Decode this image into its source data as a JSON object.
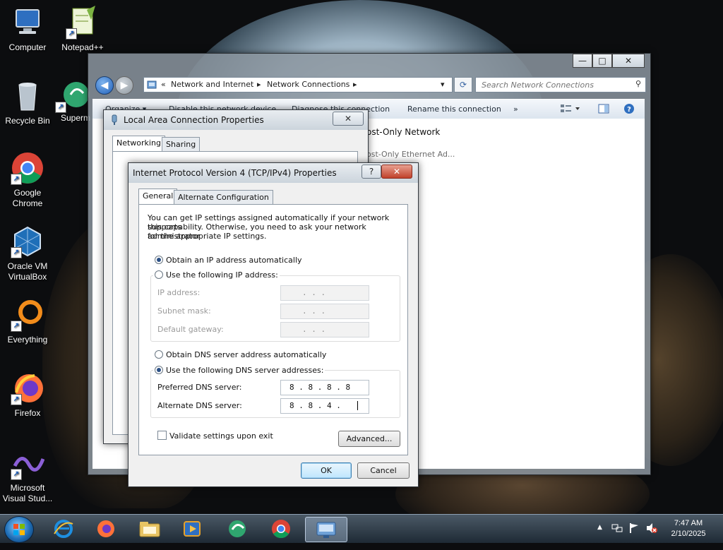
{
  "desktop": {
    "icons": [
      {
        "label_1": "Computer",
        "label_2": ""
      },
      {
        "label_1": "Notepad++",
        "label_2": ""
      },
      {
        "label_1": "Recycle Bin",
        "label_2": ""
      },
      {
        "label_1": "Superm",
        "label_2": ""
      },
      {
        "label_1": "Google",
        "label_2": "Chrome"
      },
      {
        "label_1": "Oracle VM",
        "label_2": "VirtualBox"
      },
      {
        "label_1": "Everything",
        "label_2": ""
      },
      {
        "label_1": "Firefox",
        "label_2": ""
      },
      {
        "label_1": "Microsoft",
        "label_2": "Visual Stud..."
      }
    ]
  },
  "explorer": {
    "title_buttons": {
      "minimize": "—",
      "maximize": "□",
      "close": "✕"
    },
    "address": {
      "prefix": "«",
      "crumb1": "Network and Internet",
      "sep": "▸",
      "crumb2": "Network Connections",
      "sep2": "▸",
      "dropdown": "▾"
    },
    "search_placeholder": "Search Network Connections",
    "commands": {
      "organize": "Organize ▾",
      "disable": "Disable this network device",
      "diagnose": "Diagnose this connection",
      "rename": "Rename this connection",
      "more": "»"
    },
    "items": {
      "hostonly_name": "ost-Only Network",
      "hostonly_adapter": "ost-Only Ethernet Ad..."
    }
  },
  "lac_dialog": {
    "title": "Local Area Connection Properties",
    "tabs": [
      "Networking",
      "Sharing"
    ],
    "close": "✕"
  },
  "ipv4_dialog": {
    "title": "Internet Protocol Version 4 (TCP/IPv4) Properties",
    "help": "?",
    "close": "✕",
    "tabs": [
      "General",
      "Alternate Configuration"
    ],
    "intro_1": "You can get IP settings assigned automatically if your network supports",
    "intro_2": "this capability. Otherwise, you need to ask your network administrator",
    "intro_3": "for the appropriate IP settings.",
    "ip_auto": "Obtain an IP address automatically",
    "ip_manual": "Use the following IP address:",
    "ip_address_label": "IP address:",
    "subnet_label": "Subnet mask:",
    "gateway_label": "Default gateway:",
    "empty_ip": ".     .     .",
    "dns_auto": "Obtain DNS server address automatically",
    "dns_manual": "Use the following DNS server addresses:",
    "preferred_label": "Preferred DNS server:",
    "preferred_value": "8  .  8  .  8  .  8",
    "alternate_label": "Alternate DNS server:",
    "alternate_value": "8  .  8  .  4  .",
    "validate_label": "Validate settings upon exit",
    "advanced": "Advanced...",
    "ok": "OK",
    "cancel": "Cancel"
  },
  "taskbar": {
    "clock_time": "7:47 AM",
    "clock_date": "2/10/2025",
    "tray_up": "▲"
  }
}
